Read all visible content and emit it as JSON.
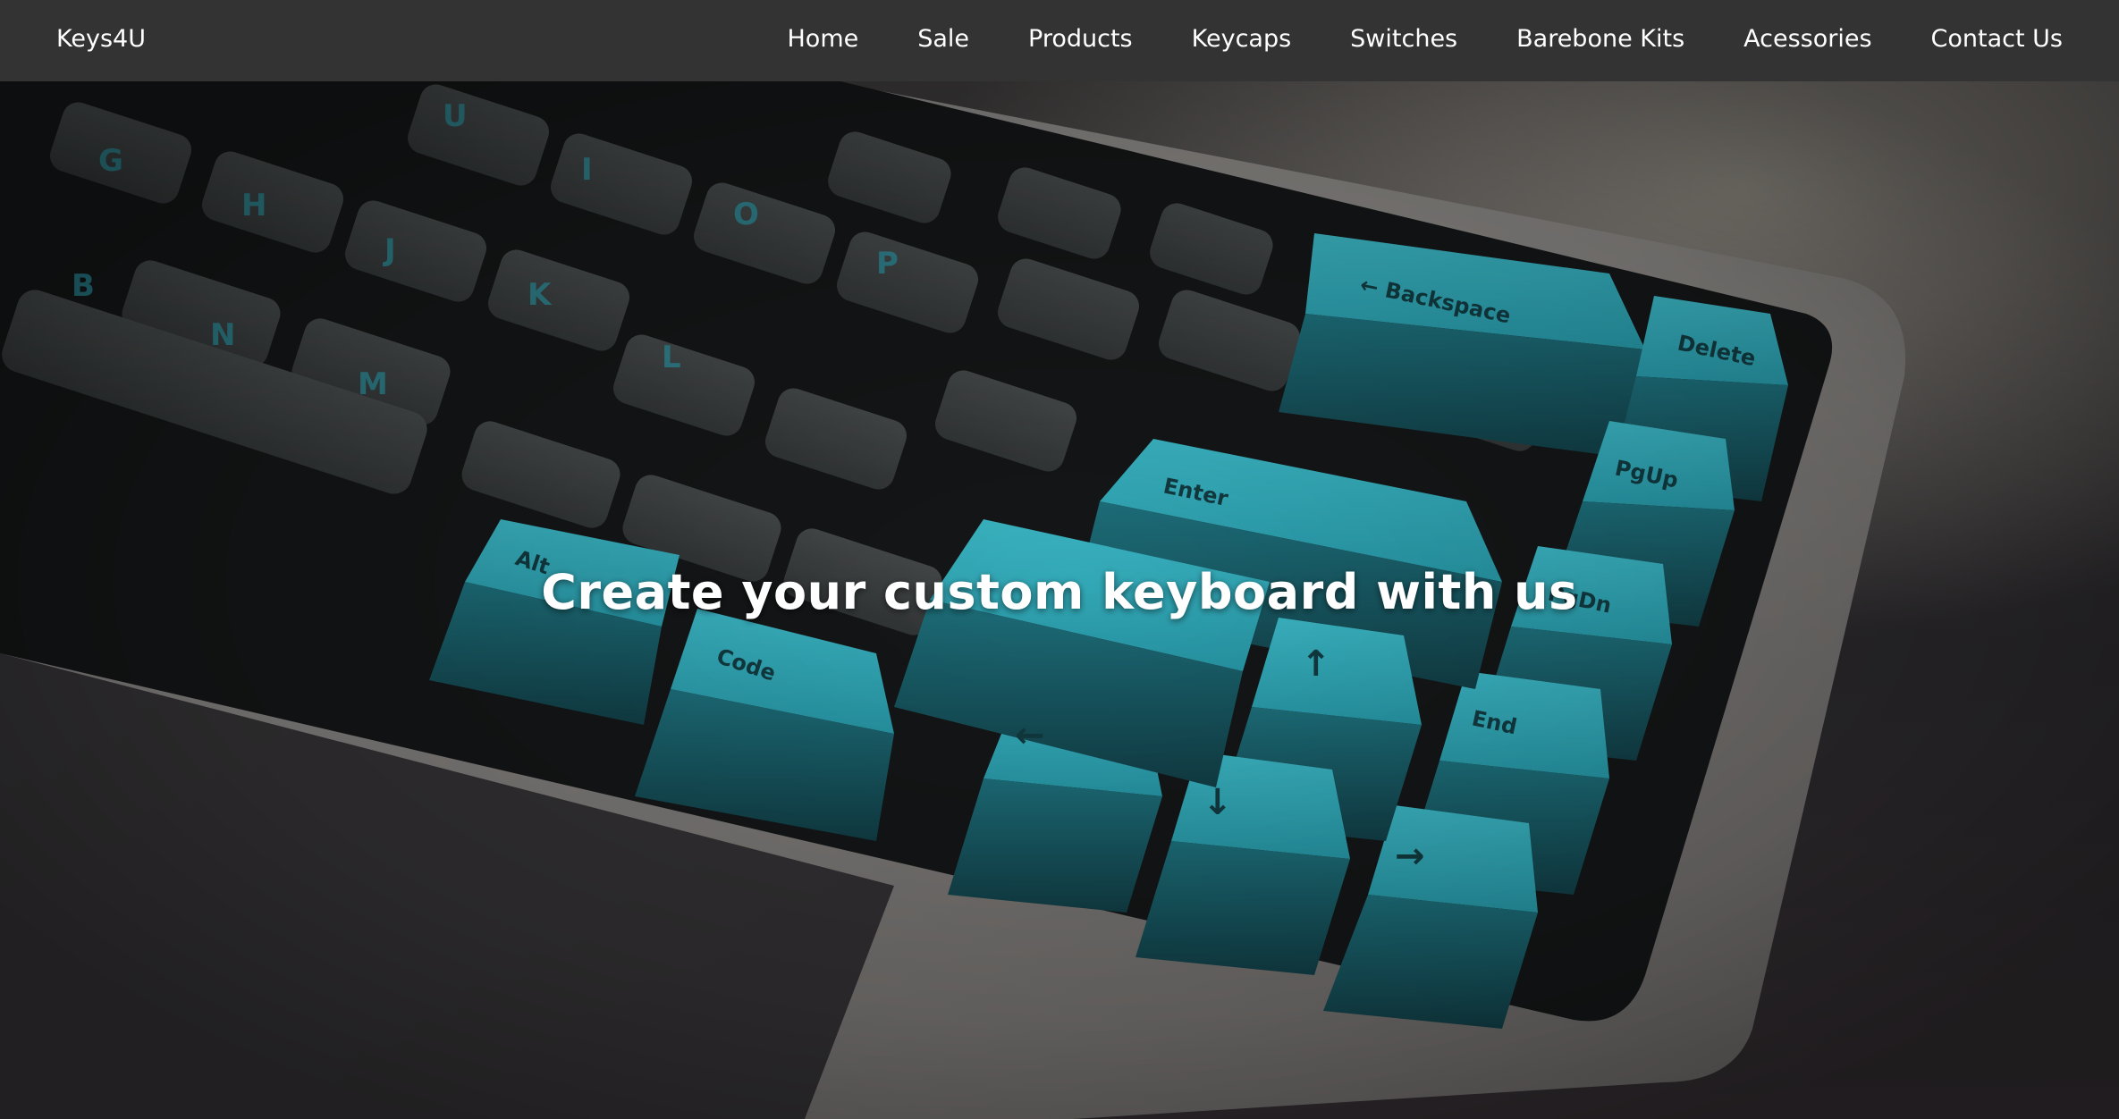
{
  "navbar": {
    "brand": "Keys4U",
    "links": [
      "Home",
      "Sale",
      "Products",
      "Keycaps",
      "Switches",
      "Barebone Kits",
      "Acessories",
      "Contact Us"
    ]
  },
  "hero": {
    "title": "Create your custom keyboard with us",
    "image_icon": "mechanical-keyboard-photo"
  },
  "colors": {
    "navbar_bg": "#333333",
    "nav_text": "#ffffff",
    "accent_keycap": "#2aa2b2",
    "dark_keycap": "#3b3e3f"
  }
}
